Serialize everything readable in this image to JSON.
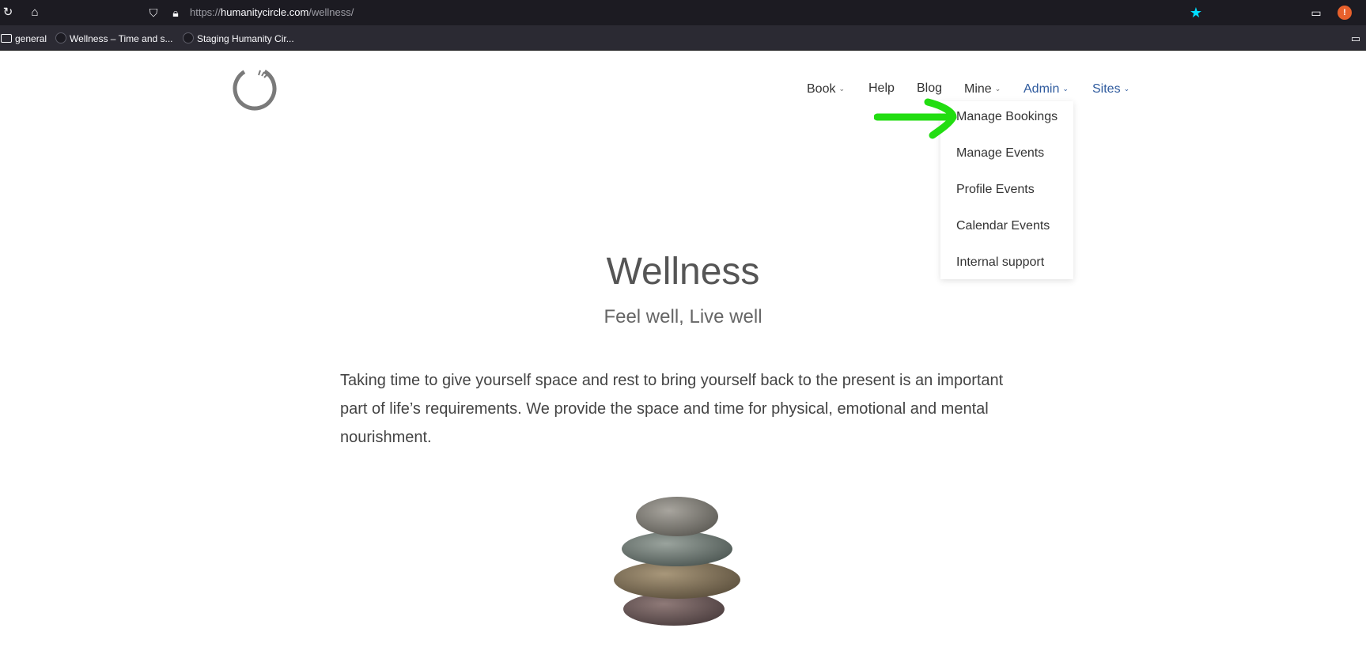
{
  "browser": {
    "url_scheme": "https://",
    "url_host": "humanitycircle.com",
    "url_path": "/wellness/",
    "bookmarks": [
      {
        "label": "general",
        "icon": "folder-icon"
      },
      {
        "label": "Wellness – Time and s...",
        "icon": "site-icon"
      },
      {
        "label": "Staging Humanity Cir...",
        "icon": "site-icon"
      }
    ],
    "star_color": "#00ddff"
  },
  "nav": {
    "items": [
      {
        "label": "Book",
        "has_caret": true
      },
      {
        "label": "Help",
        "has_caret": false
      },
      {
        "label": "Blog",
        "has_caret": false
      },
      {
        "label": "Mine",
        "has_caret": true
      },
      {
        "label": "Admin",
        "has_caret": true
      },
      {
        "label": "Sites",
        "has_caret": true
      }
    ],
    "caret": "⌄"
  },
  "dropdown": {
    "items": [
      "Manage Bookings",
      "Manage Events",
      "Profile Events",
      "Calendar Events",
      "Internal support"
    ]
  },
  "hero": {
    "title": "Wellness",
    "subtitle": "Feel well, Live well",
    "body": "Taking time to give yourself space and rest to bring yourself back to the present is an important part of life’s requirements. We provide the space and time for physical, emotional and mental nourishment."
  },
  "colors": {
    "annotation_arrow": "#22dd11",
    "link_blue": "#2f5b9e"
  }
}
